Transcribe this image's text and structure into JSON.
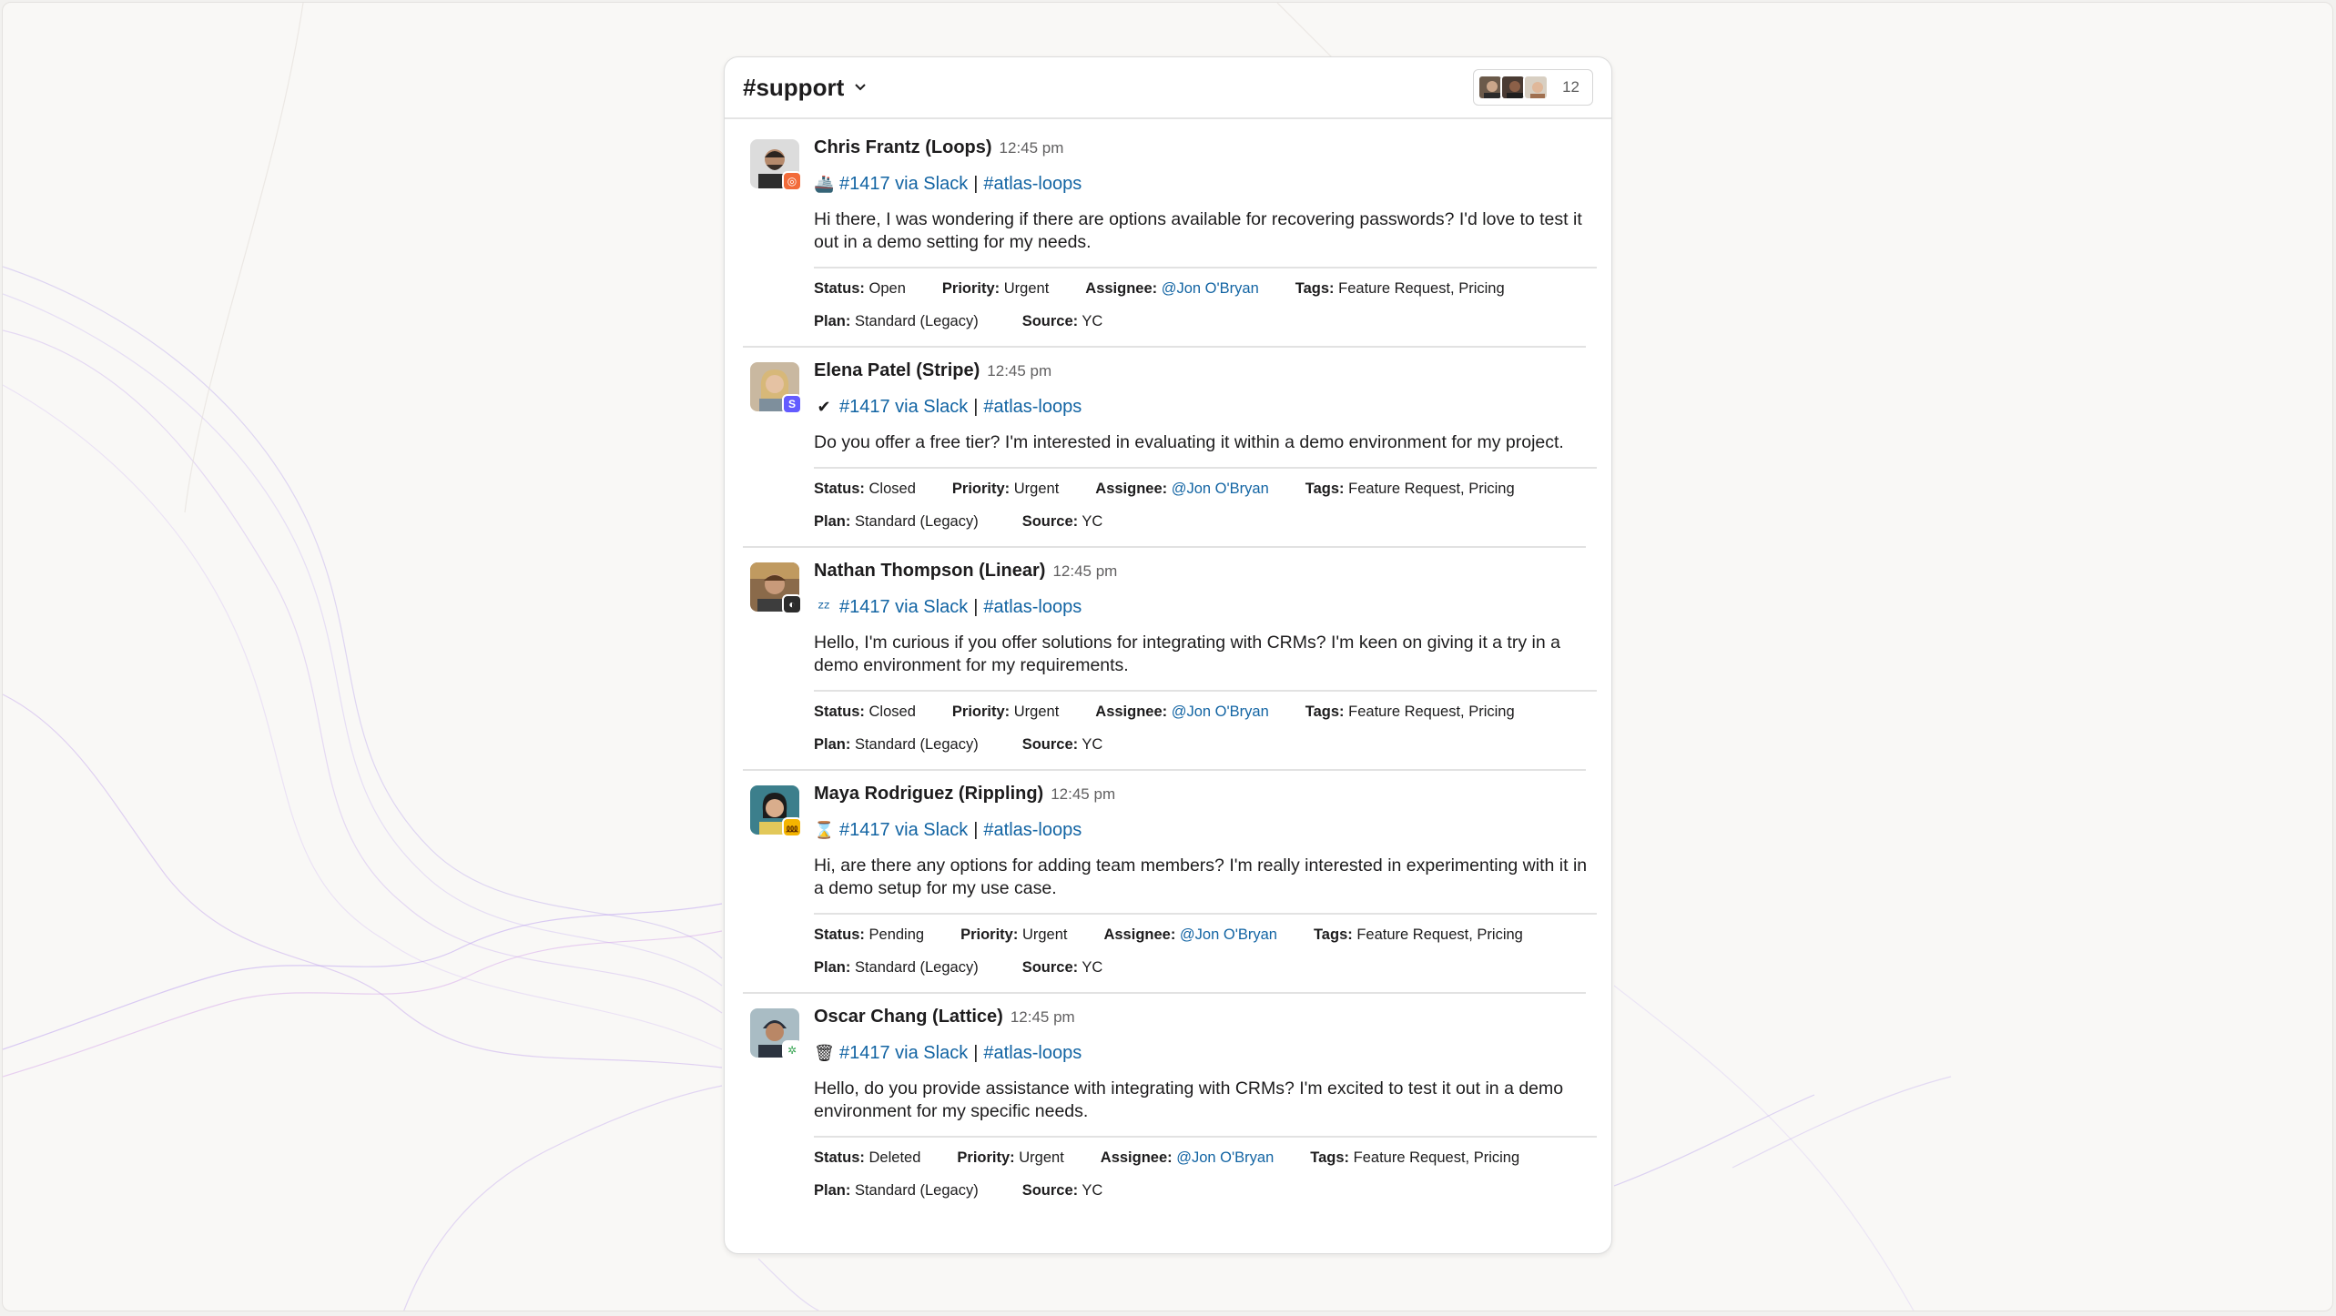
{
  "channel": {
    "name": "#support",
    "member_count": "12"
  },
  "messages": [
    {
      "author": "Chris Frantz (Loops)",
      "time": "12:45 pm",
      "status_icon": "🚢",
      "ticket": "#1417 via Slack",
      "separator": "|",
      "channel_ref": "#atlas-loops",
      "text": "Hi there, I was wondering if there are options available for recovering passwords? I'd love to test it out in a demo setting for my needs.",
      "status_label": "Status:",
      "status": "Open",
      "priority_label": "Priority:",
      "priority": "Urgent",
      "assignee_label": "Assignee:",
      "assignee": "@Jon O'Bryan",
      "tags_label": "Tags:",
      "tags": "Feature Request, Pricing",
      "plan_label": "Plan:",
      "plan": "Standard (Legacy)",
      "source_label": "Source:",
      "source": "YC",
      "badge_color": "#f26b3a",
      "badge_text": "◎"
    },
    {
      "author": "Elena Patel (Stripe)",
      "time": "12:45 pm",
      "status_icon": "✔",
      "ticket": "#1417 via Slack",
      "separator": "|",
      "channel_ref": "#atlas-loops",
      "text": "Do you offer a free tier? I'm interested in evaluating it within a demo environment for my project.",
      "status_label": "Status:",
      "status": "Closed",
      "priority_label": "Priority:",
      "priority": "Urgent",
      "assignee_label": "Assignee:",
      "assignee": "@Jon O'Bryan",
      "tags_label": "Tags:",
      "tags": "Feature Request, Pricing",
      "plan_label": "Plan:",
      "plan": "Standard (Legacy)",
      "source_label": "Source:",
      "source": "YC",
      "badge_color": "#635bff",
      "badge_text": "S"
    },
    {
      "author": "Nathan Thompson (Linear)",
      "time": "12:45 pm",
      "status_icon": "ᶻᶻ",
      "ticket": "#1417 via Slack",
      "separator": "|",
      "channel_ref": "#atlas-loops",
      "text": "Hello, I'm curious if you offer solutions for integrating with CRMs? I'm keen on giving it a try in a demo environment for my requirements.",
      "status_label": "Status:",
      "status": "Closed",
      "priority_label": "Priority:",
      "priority": "Urgent",
      "assignee_label": "Assignee:",
      "assignee": "@Jon O'Bryan",
      "tags_label": "Tags:",
      "tags": "Feature Request, Pricing",
      "plan_label": "Plan:",
      "plan": "Standard (Legacy)",
      "source_label": "Source:",
      "source": "YC",
      "badge_color": "#2b2b2b",
      "badge_text": "◐"
    },
    {
      "author": "Maya Rodriguez (Rippling)",
      "time": "12:45 pm",
      "status_icon": "⌛",
      "ticket": "#1417 via Slack",
      "separator": "|",
      "channel_ref": "#atlas-loops",
      "text": "Hi, are there any options for adding team members? I'm really interested in experimenting with it in a demo setup for my use case.",
      "status_label": "Status:",
      "status": "Pending",
      "priority_label": "Priority:",
      "priority": "Urgent",
      "assignee_label": "Assignee:",
      "assignee": "@Jon O'Bryan",
      "tags_label": "Tags:",
      "tags": "Feature Request, Pricing",
      "plan_label": "Plan:",
      "plan": "Standard (Legacy)",
      "source_label": "Source:",
      "source": "YC",
      "badge_color": "#f4b400",
      "badge_text": "⅏"
    },
    {
      "author": "Oscar Chang (Lattice)",
      "time": "12:45 pm",
      "status_icon": "🗑",
      "ticket": "#1417 via Slack",
      "separator": "|",
      "channel_ref": "#atlas-loops",
      "text": "Hello, do you provide assistance with integrating with CRMs? I'm excited to test it out in a demo environment for my specific needs.",
      "status_label": "Status:",
      "status": "Deleted",
      "priority_label": "Priority:",
      "priority": "Urgent",
      "assignee_label": "Assignee:",
      "assignee": "@Jon O'Bryan",
      "tags_label": "Tags:",
      "tags": "Feature Request, Pricing",
      "plan_label": "Plan:",
      "plan": "Standard (Legacy)",
      "source_label": "Source:",
      "source": "YC",
      "badge_color": "#ffffff",
      "badge_text": "✲"
    }
  ],
  "colors": {
    "link": "#1264a3",
    "text": "#1d1c1d",
    "muted": "#616061"
  }
}
